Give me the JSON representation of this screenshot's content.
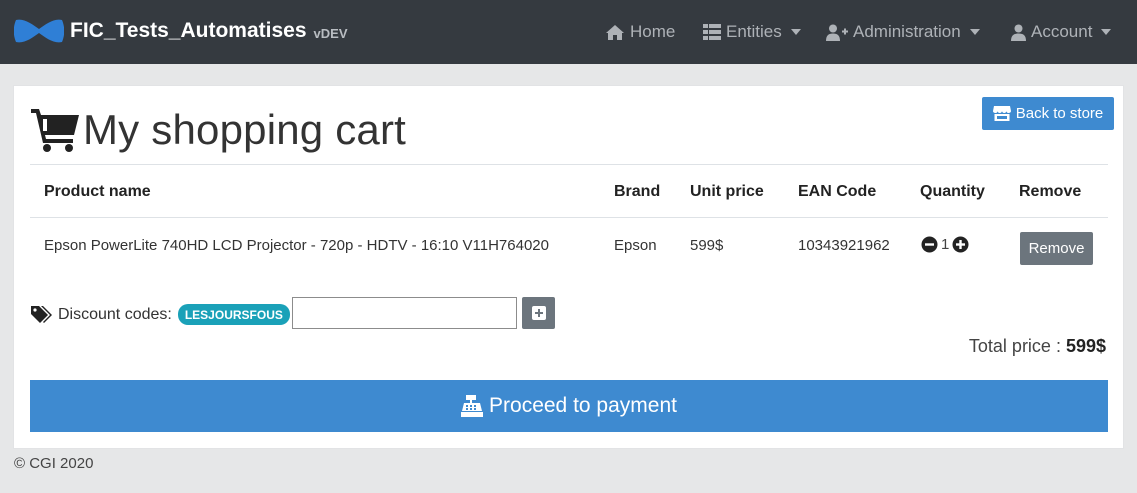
{
  "navbar": {
    "title": "FIC_Tests_Automatises",
    "version": "vDEV",
    "items": [
      {
        "label": "Home",
        "icon": "home-icon"
      },
      {
        "label": "Entities",
        "icon": "th-list-icon"
      },
      {
        "label": "Administration",
        "icon": "user-plus-icon"
      },
      {
        "label": "Account",
        "icon": "user-icon"
      }
    ]
  },
  "page": {
    "title": "My shopping cart",
    "back_label": "Back to store"
  },
  "table": {
    "headers": [
      "Product name",
      "Brand",
      "Unit price",
      "EAN Code",
      "Quantity",
      "Remove"
    ],
    "rows": [
      {
        "product": "Epson PowerLite 740HD LCD Projector - 720p - HDTV - 16:10 V11H764020",
        "brand": "Epson",
        "price": "599$",
        "ean": "10343921962",
        "quantity": "1",
        "remove_label": "Remove"
      }
    ]
  },
  "discount": {
    "label": "Discount codes:",
    "code": "LESJOURSFOUS",
    "input_value": ""
  },
  "total": {
    "label": "Total price : ",
    "value": "599$"
  },
  "payment": {
    "label": "Proceed to payment"
  },
  "footer": {
    "text": "© CGI 2020"
  },
  "colors": {
    "navbar": "#353a40",
    "primary": "#3e8ad0",
    "secondary": "#6c757d",
    "badge": "#1aa1b8"
  }
}
